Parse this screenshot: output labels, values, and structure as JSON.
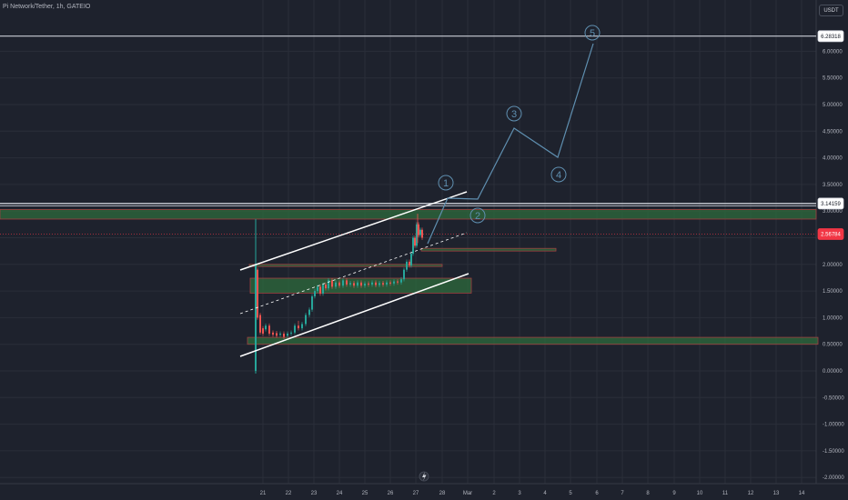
{
  "header": {
    "title": "Pi Network/Tether, 1h, GATEIO",
    "currency": "USDT"
  },
  "price_axis": {
    "ticks": [
      "6.00000",
      "5.50000",
      "5.00000",
      "4.50000",
      "4.00000",
      "3.50000",
      "3.00000",
      "2.50000",
      "2.00000",
      "1.50000",
      "1.00000",
      "0.50000",
      "0.00000",
      "-0.50000",
      "-1.00000",
      "-1.50000",
      "-2.00000"
    ]
  },
  "price_labels": {
    "top_line": "6.28318",
    "resistance_line": "3.14159",
    "last_price": "2.56784"
  },
  "time_axis": {
    "labels": [
      "21",
      "22",
      "23",
      "24",
      "25",
      "26",
      "27",
      "28",
      "Mar",
      "2",
      "3",
      "4",
      "5",
      "6",
      "7",
      "8",
      "9",
      "10",
      "11",
      "12",
      "13",
      "14"
    ]
  },
  "wave_labels": [
    "1",
    "2",
    "3",
    "4",
    "5"
  ],
  "colors": {
    "background": "#1e222d",
    "up_candle": "#26a69a",
    "down_candle": "#ef5350",
    "zone_fill": "#2e6b3c",
    "zone_border": "#a04040",
    "wave_line": "#5f8fb0",
    "last_price_badge": "#f23645"
  }
}
